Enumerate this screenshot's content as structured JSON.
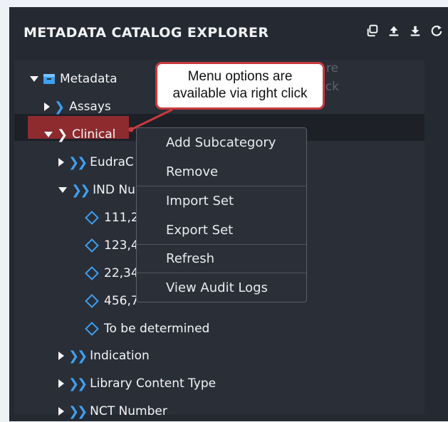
{
  "header": {
    "title": "METADATA CATALOG EXPLORER",
    "tools": [
      "copy-icon",
      "upload-icon",
      "download-icon",
      "refresh-icon"
    ]
  },
  "tree": {
    "root": "Metadata",
    "assays": "Assays",
    "clinical": "Clinical",
    "eudra": "EudraC",
    "ind": "IND Nu",
    "values": [
      "111,22",
      "123,4",
      "22,34",
      "456,7",
      "To be determined"
    ],
    "indication": "Indication",
    "library": "Library Content Type",
    "nct": "NCT Number"
  },
  "callout": {
    "line1": "Menu options are",
    "line2": "available via right click",
    "ghost1": "re",
    "ghost2": "ick"
  },
  "context_menu": {
    "items": [
      "Add Subcategory",
      "Remove",
      "Import Set",
      "Export Set",
      "Refresh",
      "View Audit Logs"
    ]
  },
  "colors": {
    "panel": "#252932",
    "accent": "#3ea0f0",
    "highlight": "#8e2b2e",
    "callout_border": "#c93a3f"
  }
}
